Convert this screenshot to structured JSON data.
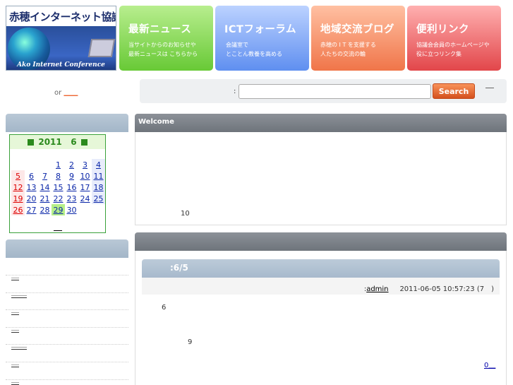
{
  "header": {
    "logo": {
      "title": "赤穂インターネット協議会",
      "subtitle": "Ako Internet Conference"
    },
    "nav": [
      {
        "title": "最新ニュース",
        "lines": [
          "当サイトからのお知らせや",
          "最新ニュースは こちらから"
        ]
      },
      {
        "title": "ICTフォーラム",
        "lines": [
          "会議室で",
          "とことん教養を高める"
        ]
      },
      {
        "title": "地域交流ブログ",
        "lines": [
          "赤穂の I T を支援する",
          "人たちの交流の輪"
        ]
      },
      {
        "title": "便利リンク",
        "lines": [
          "協議会会員のホームページや",
          "役に立つリンク集"
        ]
      }
    ]
  },
  "topbar": {
    "or_text": "or",
    "or_link": "＿＿",
    "search_colon": ":",
    "search_value": "",
    "search_button": "Search",
    "right_link": "＿"
  },
  "calendar": {
    "year": "2011",
    "month": "6",
    "weeks": [
      [
        "",
        "",
        "",
        "1",
        "2",
        "3",
        "4"
      ],
      [
        "5",
        "6",
        "7",
        "8",
        "9",
        "10",
        "11"
      ],
      [
        "12",
        "13",
        "14",
        "15",
        "16",
        "17",
        "18"
      ],
      [
        "19",
        "20",
        "21",
        "22",
        "23",
        "24",
        "25"
      ],
      [
        "26",
        "27",
        "28",
        "29",
        "30",
        "",
        ""
      ]
    ],
    "today": "29",
    "footer_link": "＿"
  },
  "sidebar_links": [
    "＿",
    "＿＿",
    "＿",
    "＿",
    "＿＿",
    "＿",
    "＿"
  ],
  "welcome": {
    "title": "Welcome",
    "number": "10"
  },
  "entry": {
    "title": ":6/5",
    "meta_prefix": ":",
    "author": "admin",
    "datetime": "2011-06-05 10:57:23 (7　)",
    "num1": "6",
    "num2": "9",
    "comments": "0＿"
  },
  "colors": {
    "accent_orange": "#e0612a",
    "calendar_green": "#3aa13a",
    "nav_green": "#68c936",
    "nav_blue": "#5f8ff0",
    "nav_orange": "#f07549",
    "nav_red": "#e2464a"
  }
}
